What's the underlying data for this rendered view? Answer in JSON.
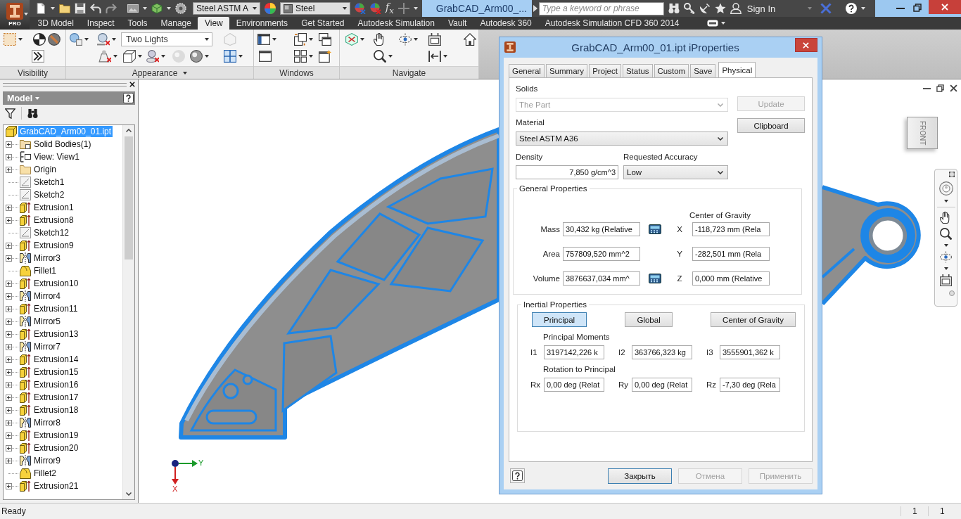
{
  "app_menu": {
    "badge": "PRO"
  },
  "quick_access": {
    "material": "Steel ASTM A",
    "appearance": "Steel",
    "formula": "f$_{x}$"
  },
  "title": "GrabCAD_Arm00_...",
  "search": {
    "placeholder": "Type a keyword or phrase"
  },
  "account": {
    "label": "Sign In"
  },
  "ribbon_tabs": [
    {
      "label": "3D Model",
      "selected": false
    },
    {
      "label": "Inspect",
      "selected": false
    },
    {
      "label": "Tools",
      "selected": false
    },
    {
      "label": "Manage",
      "selected": false
    },
    {
      "label": "View",
      "selected": true
    },
    {
      "label": "Environments",
      "selected": false
    },
    {
      "label": "Get Started",
      "selected": false
    },
    {
      "label": "Autodesk Simulation",
      "selected": false
    },
    {
      "label": "Vault",
      "selected": false
    },
    {
      "label": "Autodesk 360",
      "selected": false
    },
    {
      "label": "Autodesk Simulation CFD 360 2014",
      "selected": false
    }
  ],
  "ribbon": {
    "lighting": "Two Lights",
    "panels": [
      {
        "label": "Visibility",
        "menu": false
      },
      {
        "label": "Appearance",
        "menu": true
      },
      {
        "label": "Windows",
        "menu": false
      },
      {
        "label": "Navigate",
        "menu": false
      }
    ]
  },
  "browser": {
    "title": "Model",
    "tree": [
      {
        "label": "GrabCAD_Arm00_01.ipt",
        "kind": "part",
        "selected": true,
        "children": [
          {
            "label": "Solid Bodies(1)",
            "kind": "bodies",
            "expandable": true,
            "selected": false
          },
          {
            "label": "View: View1",
            "kind": "view",
            "expandable": true,
            "selected": false
          },
          {
            "label": "Origin",
            "kind": "folder",
            "expandable": true,
            "selected": false
          },
          {
            "label": "Sketch1",
            "kind": "sketch",
            "expandable": false,
            "selected": false
          },
          {
            "label": "Sketch2",
            "kind": "sketch",
            "expandable": false,
            "selected": false
          },
          {
            "label": "Extrusion1",
            "kind": "extrusion",
            "expandable": true,
            "selected": false
          },
          {
            "label": "Extrusion8",
            "kind": "extrusion",
            "expandable": true,
            "selected": false
          },
          {
            "label": "Sketch12",
            "kind": "sketch",
            "expandable": false,
            "selected": false
          },
          {
            "label": "Extrusion9",
            "kind": "extrusion",
            "expandable": true,
            "selected": false
          },
          {
            "label": "Mirror3",
            "kind": "mirror",
            "expandable": true,
            "selected": false
          },
          {
            "label": "Fillet1",
            "kind": "fillet",
            "expandable": false,
            "selected": false
          },
          {
            "label": "Extrusion10",
            "kind": "extrusion",
            "expandable": true,
            "selected": false
          },
          {
            "label": "Mirror4",
            "kind": "mirror",
            "expandable": true,
            "selected": false
          },
          {
            "label": "Extrusion11",
            "kind": "extrusion",
            "expandable": true,
            "selected": false
          },
          {
            "label": "Mirror5",
            "kind": "mirror",
            "expandable": true,
            "selected": false
          },
          {
            "label": "Extrusion13",
            "kind": "extrusion",
            "expandable": true,
            "selected": false
          },
          {
            "label": "Mirror7",
            "kind": "mirror",
            "expandable": true,
            "selected": false
          },
          {
            "label": "Extrusion14",
            "kind": "extrusion",
            "expandable": true,
            "selected": false
          },
          {
            "label": "Extrusion15",
            "kind": "extrusion",
            "expandable": true,
            "selected": false
          },
          {
            "label": "Extrusion16",
            "kind": "extrusion",
            "expandable": true,
            "selected": false
          },
          {
            "label": "Extrusion17",
            "kind": "extrusion",
            "expandable": true,
            "selected": false
          },
          {
            "label": "Extrusion18",
            "kind": "extrusion",
            "expandable": true,
            "selected": false
          },
          {
            "label": "Mirror8",
            "kind": "mirror",
            "expandable": true,
            "selected": false
          },
          {
            "label": "Extrusion19",
            "kind": "extrusion",
            "expandable": true,
            "selected": false
          },
          {
            "label": "Extrusion20",
            "kind": "extrusion",
            "expandable": true,
            "selected": false
          },
          {
            "label": "Mirror9",
            "kind": "mirror",
            "expandable": true,
            "selected": false
          },
          {
            "label": "Fillet2",
            "kind": "fillet",
            "expandable": false,
            "selected": false
          },
          {
            "label": "Extrusion21",
            "kind": "extrusion",
            "expandable": true,
            "selected": false
          }
        ]
      }
    ]
  },
  "viewport": {
    "view_cube": "FRONT",
    "axes": {
      "y": "Y",
      "x": "X"
    }
  },
  "dialog": {
    "title": "GrabCAD_Arm00_01.ipt iProperties",
    "tabs": [
      {
        "label": "General",
        "selected": false
      },
      {
        "label": "Summary",
        "selected": false
      },
      {
        "label": "Project",
        "selected": false
      },
      {
        "label": "Status",
        "selected": false
      },
      {
        "label": "Custom",
        "selected": false
      },
      {
        "label": "Save",
        "selected": false
      },
      {
        "label": "Physical",
        "selected": true
      }
    ],
    "solids": {
      "label": "Solids",
      "value": "The Part",
      "disabled": true
    },
    "material": {
      "label": "Material",
      "value": "Steel ASTM A36"
    },
    "side_buttons": [
      {
        "label": "Update",
        "disabled": true
      },
      {
        "label": "Clipboard",
        "disabled": false
      }
    ],
    "density": {
      "label": "Density",
      "value": "7,850 g/cm^3"
    },
    "accuracy": {
      "label": "Requested Accuracy",
      "value": "Low"
    },
    "general": {
      "title": "General Properties",
      "cog_title": "Center of Gravity",
      "rows": [
        {
          "label": "Mass",
          "value": "30,432 kg (Relative",
          "calculator": true,
          "axis": "X",
          "cog": "-118,723 mm (Rela"
        },
        {
          "label": "Area",
          "value": "757809,520 mm^2",
          "calculator": false,
          "axis": "Y",
          "cog": "-282,501 mm (Rela"
        },
        {
          "label": "Volume",
          "value": "3876637,034 mm^",
          "calculator": true,
          "axis": "Z",
          "cog": "0,000 mm (Relative"
        }
      ]
    },
    "inertial": {
      "title": "Inertial Properties",
      "modes": [
        {
          "label": "Principal",
          "selected": true
        },
        {
          "label": "Global",
          "selected": false
        },
        {
          "label": "Center of Gravity",
          "selected": false
        }
      ],
      "sections": [
        {
          "title": "Principal Moments",
          "items": [
            {
              "label": "I1",
              "value": "3197142,226 k"
            },
            {
              "label": "I2",
              "value": "363766,323 kg"
            },
            {
              "label": "I3",
              "value": "3555901,362 k"
            }
          ]
        },
        {
          "title": "Rotation to Principal",
          "items": [
            {
              "label": "Rx",
              "value": "0,00 deg (Relat"
            },
            {
              "label": "Ry",
              "value": "0,00 deg (Relat"
            },
            {
              "label": "Rz",
              "value": "-7,30 deg (Rela"
            }
          ]
        }
      ]
    },
    "buttons": [
      {
        "label": "Закрыть",
        "disabled": false,
        "default": true
      },
      {
        "label": "Отмена",
        "disabled": true,
        "default": false
      },
      {
        "label": "Применить",
        "disabled": true,
        "default": false
      }
    ]
  },
  "status_bar": {
    "message": "Ready",
    "fields": [
      "1",
      "1"
    ]
  }
}
